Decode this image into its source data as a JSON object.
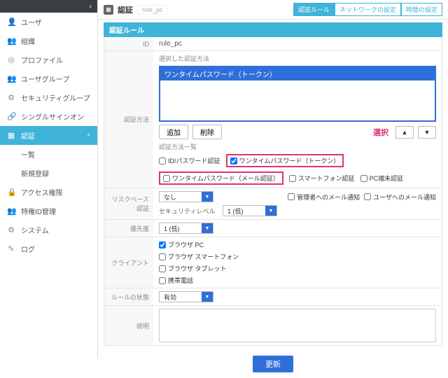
{
  "sidebar": {
    "collapse": "‹",
    "items": [
      {
        "icon": "👤",
        "label": "ユーザ"
      },
      {
        "icon": "👥",
        "label": "組織"
      },
      {
        "icon": "◎",
        "label": "プロファイル"
      },
      {
        "icon": "👥",
        "label": "ユーザグループ"
      },
      {
        "icon": "⚙",
        "label": "セキュリティグループ"
      },
      {
        "icon": "🔗",
        "label": "シングルサインオン"
      }
    ],
    "active": {
      "icon": "▦",
      "label": "認証",
      "caret": "˄"
    },
    "subs": [
      "一覧",
      "新規登録"
    ],
    "items2": [
      {
        "icon": "🔒",
        "label": "アクセス権限"
      },
      {
        "icon": "👥",
        "label": "特権ID管理"
      },
      {
        "icon": "⚙",
        "label": "システム"
      },
      {
        "icon": "✎",
        "label": "ログ"
      }
    ]
  },
  "crumb": {
    "icon": "▦",
    "title": "認証",
    "sub": "rule_pc"
  },
  "tabs": [
    {
      "label": "認証ルール",
      "active": true
    },
    {
      "label": "ネットワークの設定",
      "active": false
    },
    {
      "label": "時間の設定",
      "active": false
    }
  ],
  "panel": {
    "title": "認証ルール"
  },
  "form": {
    "id_label": "ID",
    "id_value": "rule_pc",
    "method_label": "認証方法",
    "selected_label": "選択した認証方法",
    "selected_value": "ワンタイムパスワード（トークン）",
    "add_btn": "追加",
    "del_btn": "削除",
    "highlight": "選択",
    "list_label": "認証方法一覧",
    "opts": {
      "idpw": "ID/パスワード認証",
      "otp_token": "ワンタイムパスワード（トークン）",
      "otp_mail": "ワンタイムパスワード（メール認証）",
      "smartphone": "スマートフォン認証",
      "pc_term": "PC端末認証"
    },
    "risk_label": "リスクベース認証",
    "risk_val": "なし",
    "notify_admin": "管理者へのメール通知",
    "notify_user": "ユーザへのメール通知",
    "seclevel_label": "セキュリティレベル",
    "seclevel_val": "1 (低)",
    "priority_label": "優先度",
    "priority_val": "1 (低)",
    "client_label": "クライアント",
    "clients": {
      "pc": "ブラウザ PC",
      "sp": "ブラウザ スマートフォン",
      "tab": "ブラウザ タブレット",
      "mob": "携帯電話"
    },
    "state_label": "ルールの状態",
    "state_val": "有効",
    "desc_label": "説明",
    "update": "更新"
  }
}
